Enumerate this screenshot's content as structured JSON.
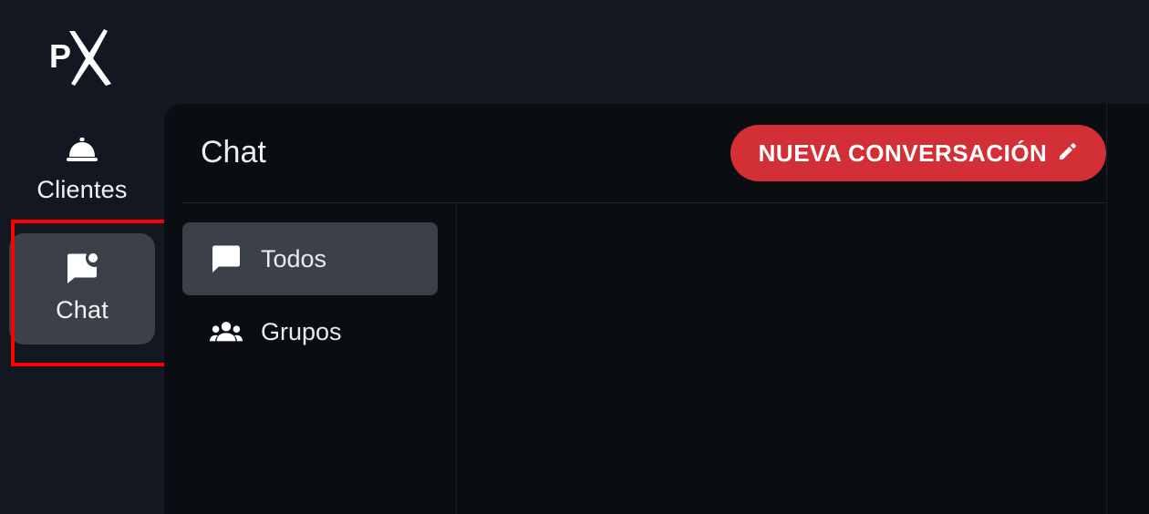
{
  "brand": {
    "logo_text": "PX"
  },
  "rail": {
    "items": [
      {
        "label": "Clientes",
        "icon": "bell-concierge-icon"
      },
      {
        "label": "Chat",
        "icon": "chat-notification-icon",
        "active": true
      }
    ]
  },
  "header": {
    "title": "Chat",
    "new_conversation_label": "NUEVA CONVERSACIÓN",
    "new_conversation_icon": "pencil-icon"
  },
  "filters": {
    "items": [
      {
        "label": "Todos",
        "icon": "chat-bubble-icon",
        "active": true
      },
      {
        "label": "Grupos",
        "icon": "group-icon",
        "active": false
      }
    ]
  },
  "colors": {
    "background": "#131722",
    "panel": "#0a0d12",
    "active_item": "#3c4049",
    "accent_button": "#d22f36",
    "highlight_box": "#ff0000"
  }
}
